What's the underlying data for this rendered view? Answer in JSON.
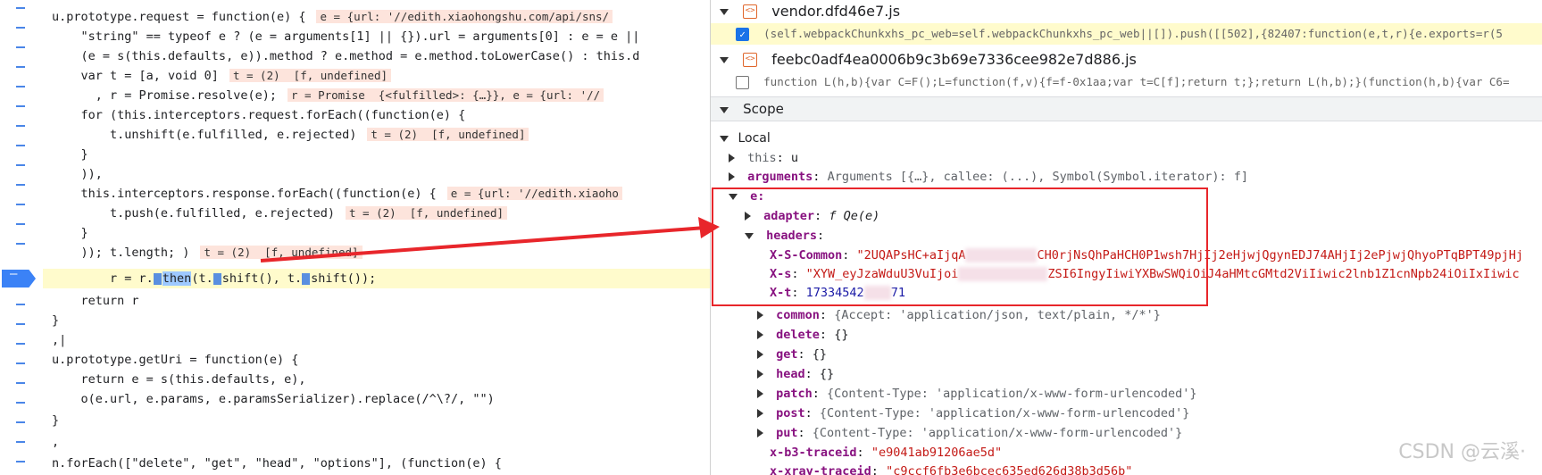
{
  "editor": {
    "lines": [
      {
        "t": "u.prototype.request = function(e) {",
        "inl": "e = {url: '//edith.xiaohongshu.com/api/sns/"
      },
      {
        "t": "    \"string\" == typeof e ? (e = arguments[1] || {}).url = arguments[0] : e = e ||",
        "inl": ""
      },
      {
        "t": "    (e = s(this.defaults, e)).method ? e.method = e.method.toLowerCase() : this.d",
        "inl": ""
      },
      {
        "t": "    var t = [a, void 0]",
        "inl": "t = (2)  [f, undefined]"
      },
      {
        "t": "      , r = Promise.resolve(e);",
        "inl": "r = Promise  {<fulfilled>: {…}}, e = {url: '//"
      },
      {
        "t": "    for (this.interceptors.request.forEach((function(e) {",
        "inl": ""
      },
      {
        "t": "        t.unshift(e.fulfilled, e.rejected)",
        "inl": "t = (2)  [f, undefined]"
      },
      {
        "t": "    }",
        "inl": ""
      },
      {
        "t": "    )),",
        "inl": ""
      },
      {
        "t": "    this.interceptors.response.forEach((function(e) {",
        "inl": "e = {url: '//edith.xiaoho"
      },
      {
        "t": "        t.push(e.fulfilled, e.rejected)",
        "inl": "t = (2)  [f, undefined]"
      },
      {
        "t": "    }",
        "inl": ""
      },
      {
        "t": "    )); t.length; )",
        "inl": "t = (2)  [f, undefined]"
      },
      {
        "t": "        r = r.",
        "inl": ""
      },
      {
        "t": "    return r",
        "inl": ""
      },
      {
        "t": "}",
        "inl": ""
      },
      {
        "t": ",|",
        "inl": ""
      },
      {
        "t": "u.prototype.getUri = function(e) {",
        "inl": ""
      },
      {
        "t": "    return e = s(this.defaults, e),",
        "inl": ""
      },
      {
        "t": "    o(e.url, e.params, e.paramsSerializer).replace(/^\\?/, \"\")",
        "inl": ""
      },
      {
        "t": "}",
        "inl": ""
      },
      {
        "t": ",",
        "inl": ""
      },
      {
        "t": "n.forEach([\"delete\", \"get\", \"head\", \"options\"], (function(e) {",
        "inl": ""
      }
    ],
    "paused_line_then": "then",
    "paused_line_rest": "(t.",
    "shift_a": "shift(), t.",
    "shift_b": "shift());"
  },
  "panel": {
    "files": [
      {
        "name": "vendor.dfd46e7.js",
        "snippet": "(self.webpackChunkxhs_pc_web=self.webpackChunkxhs_pc_web||[]).push([[502],{82407:function(e,t,r){e.exports=r(5",
        "checked": true
      },
      {
        "name": "feebc0adf4ea0006b9c3b69e7336cee982e7d886.js",
        "snippet": "function L(h,b){var C=F();L=function(f,v){f=f-0x1aa;var t=C[f];return t;};return L(h,b);}(function(h,b){var C6=",
        "checked": false
      }
    ],
    "scope_title": "Scope",
    "local_title": "Local",
    "this_key": "this",
    "this_val": "u",
    "arguments_key": "arguments",
    "arguments_val": "Arguments  [{…}, callee: (...), Symbol(Symbol.iterator): f]",
    "e_key": "e:",
    "adapter_key": "adapter",
    "adapter_val": "f Qe(e)",
    "headers_key": "headers",
    "xsc_key": "X-S-Common",
    "xsc_val_a": "\"2UQAPsHC+aIjqA",
    "xsc_val_b": "CH0rjNsQhPaHCH0P1wsh7HjIj2eHjwjQgynEDJ74AHjIj2ePjwjQhyoPTqBPT49pjHj",
    "xs_key": "X-s",
    "xs_val_a": "\"XYW_eyJzaWduU3VuIjoi",
    "xs_val_b": "ZSI6IngyIiwiYXBwSWQiOiJ4aHMtcGMtd2ViIiwic2lnb1Z1cnNpb24iOiIxIiwic",
    "xt_key": "X-t",
    "xt_val_a": "17334542",
    "xt_val_b": "71",
    "common_key": "common",
    "common_val": "{Accept: 'application/json, text/plain, */*'}",
    "delete_key": "delete",
    "delete_val": "{}",
    "get_key": "get",
    "get_val": "{}",
    "head_key": "head",
    "head_val": "{}",
    "patch_key": "patch",
    "patch_val": "{Content-Type: 'application/x-www-form-urlencoded'}",
    "post_key": "post",
    "post_val": "{Content-Type: 'application/x-www-form-urlencoded'}",
    "put_key": "put",
    "put_val": "{Content-Type: 'application/x-www-form-urlencoded'}",
    "b3_key": "x-b3-traceid",
    "b3_val": "\"e9041ab91206ae5d\"",
    "xray_key": "x-xray-traceid",
    "xray_val": "\"c9ccf6fb3e6bcec635ed626d38b3d56b\""
  },
  "watermark": "CSDN @云溪·",
  "colors": {
    "annotation": "#e8262b",
    "paused_line": "#fffbcc",
    "breakpoint": "#3b82f6"
  }
}
